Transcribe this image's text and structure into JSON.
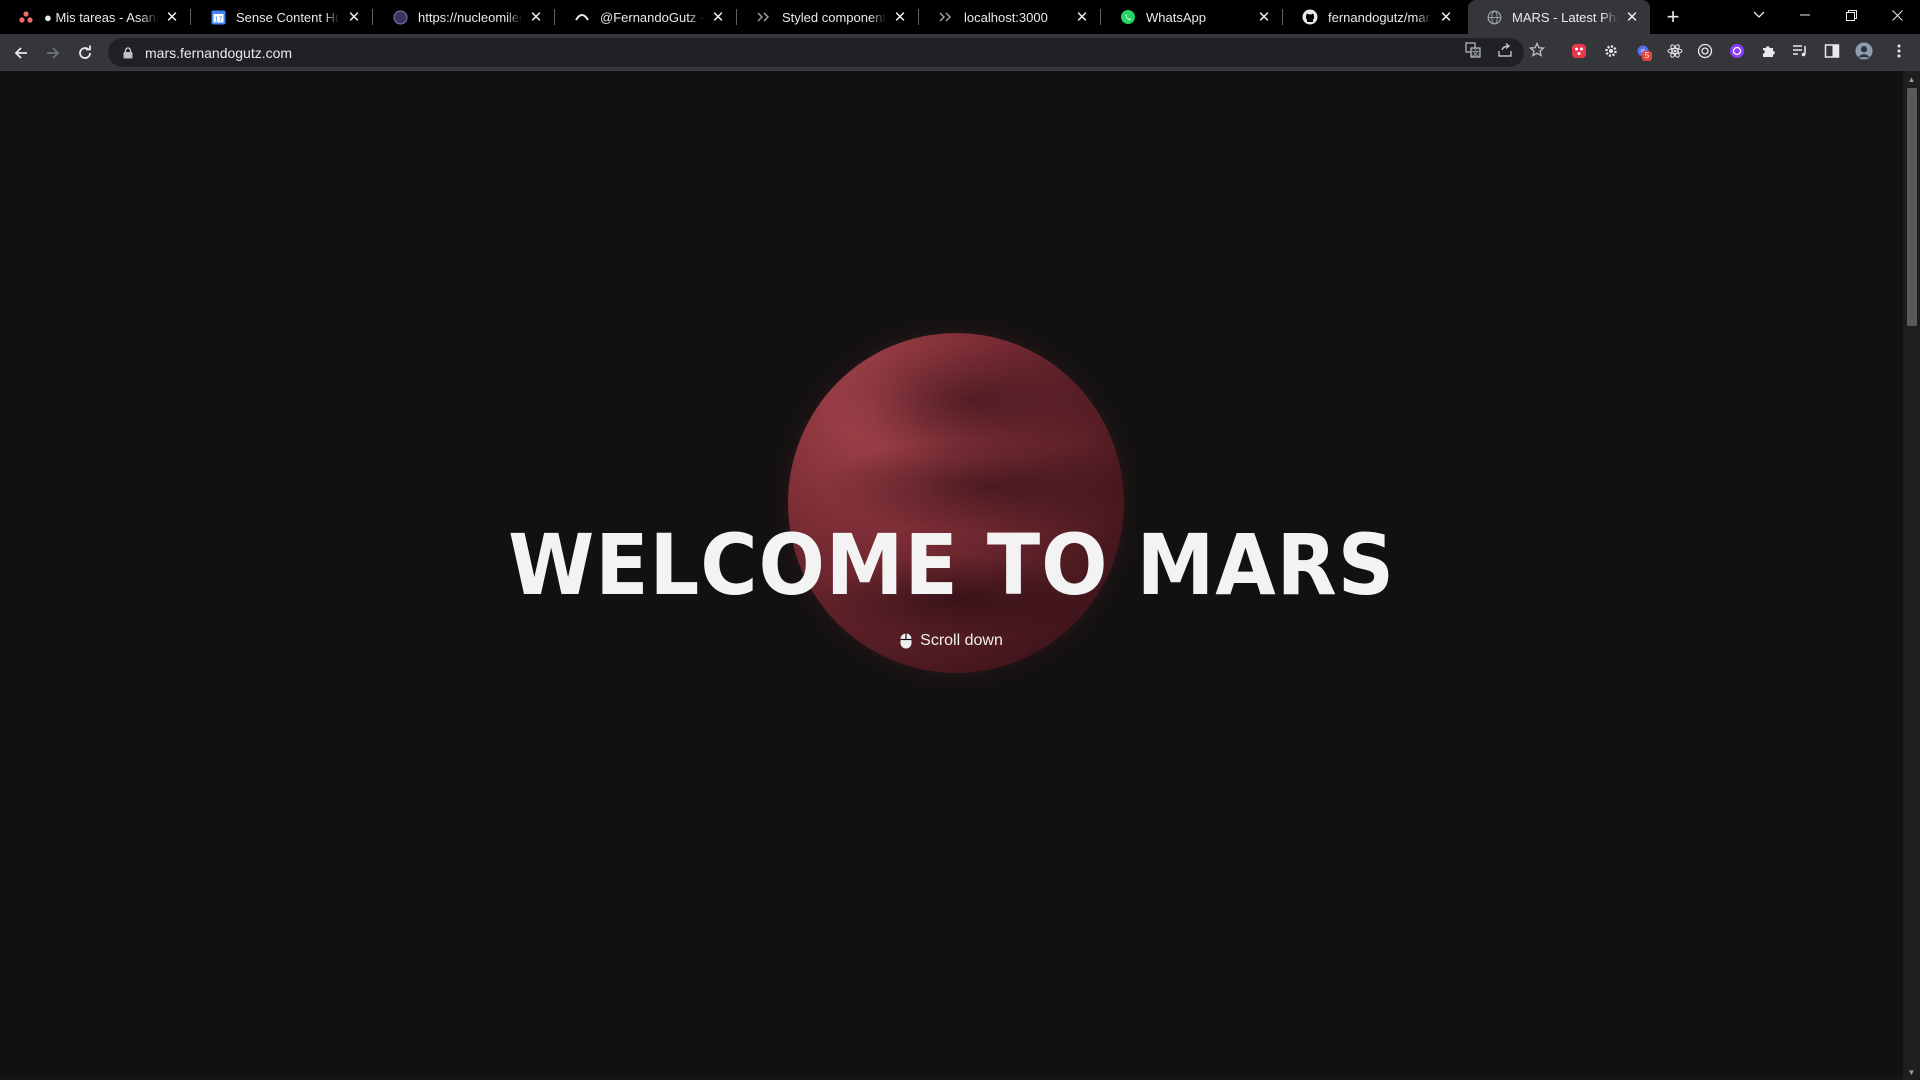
{
  "browser": {
    "tabs": [
      {
        "title": "● Mis tareas - Asana",
        "icon": "asana-icon",
        "active": false
      },
      {
        "title": "Sense Content Hub - C",
        "icon": "calendar-icon",
        "active": false
      },
      {
        "title": "https://nucleomilenio.c",
        "icon": "globe-icon",
        "active": false
      },
      {
        "title": "@FernandoGutz - Port",
        "icon": "arc-icon",
        "active": false
      },
      {
        "title": "Styled components - I",
        "icon": "chevrons-icon",
        "active": false
      },
      {
        "title": "localhost:3000",
        "icon": "chevrons-icon",
        "active": false
      },
      {
        "title": "WhatsApp",
        "icon": "whatsapp-icon",
        "active": false
      },
      {
        "title": "fernandogutz/mars",
        "icon": "github-icon",
        "active": false
      },
      {
        "title": "MARS - Latest Photos",
        "icon": "globe-icon",
        "active": true
      }
    ],
    "url": "mars.fernandogutz.com",
    "extension_badge": "5"
  },
  "page": {
    "title": "WELCOME TO MARS",
    "scroll_hint": "Scroll down"
  },
  "colors": {
    "background": "#111111",
    "planet": "#7c2d35",
    "title": "#f3f3f3"
  }
}
